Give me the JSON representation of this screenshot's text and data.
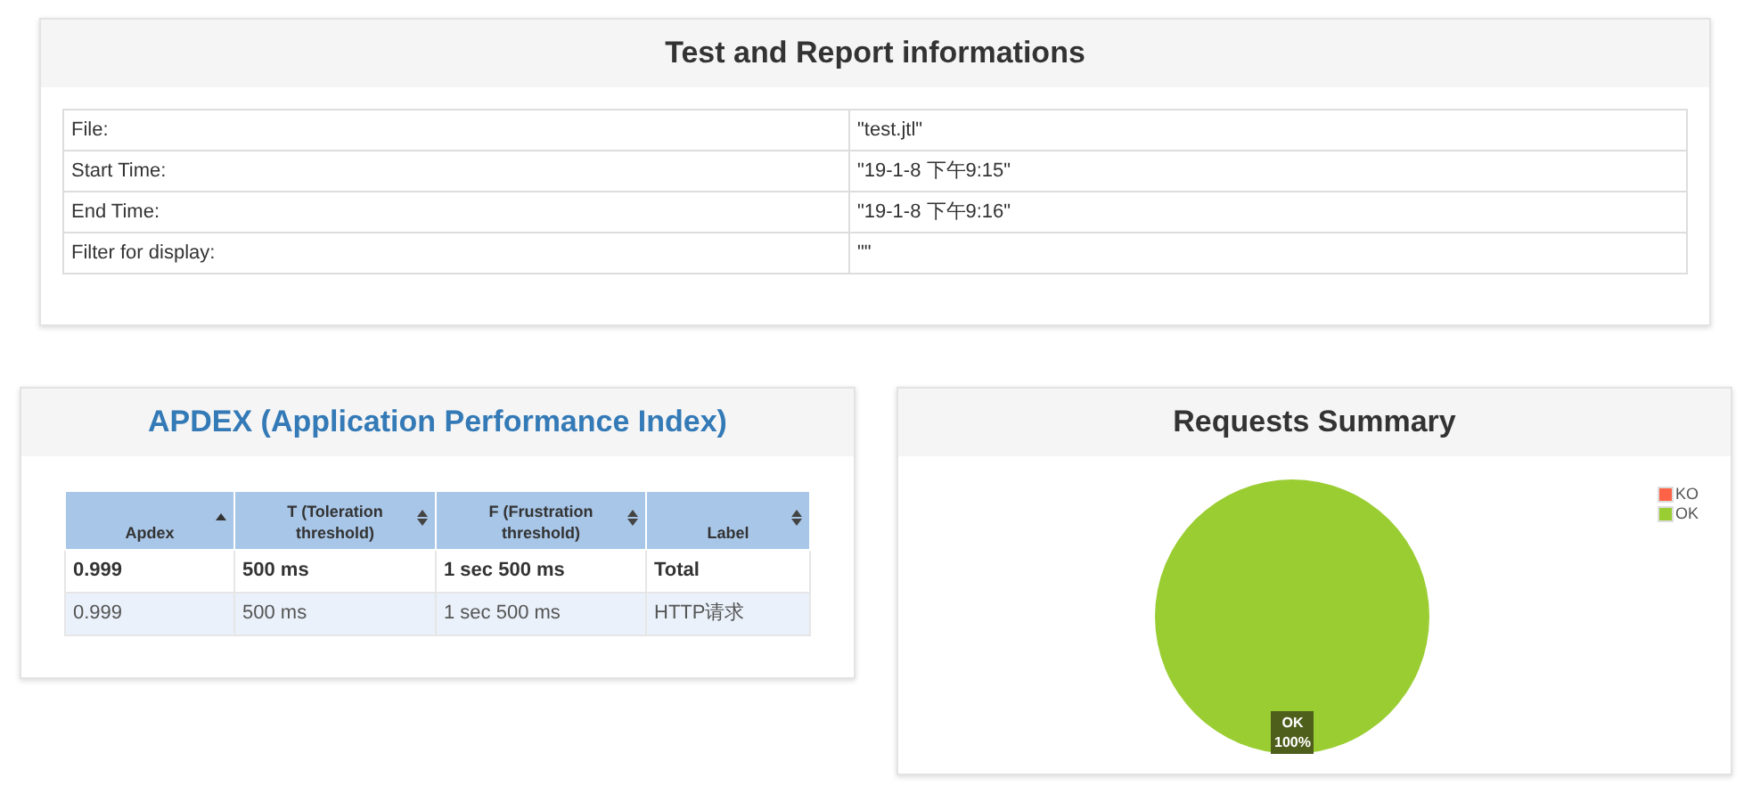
{
  "info_panel": {
    "title": "Test and Report informations",
    "rows": [
      {
        "label": "File:",
        "value": "\"test.jtl\""
      },
      {
        "label": "Start Time:",
        "value": "\"19-1-8 下午9:15\""
      },
      {
        "label": "End Time:",
        "value": "\"19-1-8 下午9:16\""
      },
      {
        "label": "Filter for display:",
        "value": "\"\""
      }
    ]
  },
  "apdex_panel": {
    "title": "APDEX (Application Performance Index)",
    "columns": [
      {
        "label": "Apdex",
        "kind": "ascending"
      },
      {
        "label": "T (Toleration threshold)",
        "kind": "sortable"
      },
      {
        "label": "F (Frustration threshold)",
        "kind": "sortable"
      },
      {
        "label": "Label",
        "kind": "sortable"
      }
    ],
    "rows": [
      {
        "kind": "total",
        "cells": [
          "0.999",
          "500 ms",
          "1 sec 500 ms",
          "Total"
        ]
      },
      {
        "kind": "item",
        "cells": [
          "0.999",
          "500 ms",
          "1 sec 500 ms",
          "HTTP请求"
        ]
      }
    ]
  },
  "summary_panel": {
    "title": "Requests Summary",
    "chart_data": {
      "type": "pie",
      "categories": [
        "KO",
        "OK"
      ],
      "values": [
        0,
        100
      ],
      "colors": [
        "#ff6347",
        "#9acd32"
      ],
      "value_labels": [
        null,
        "100%"
      ]
    }
  }
}
